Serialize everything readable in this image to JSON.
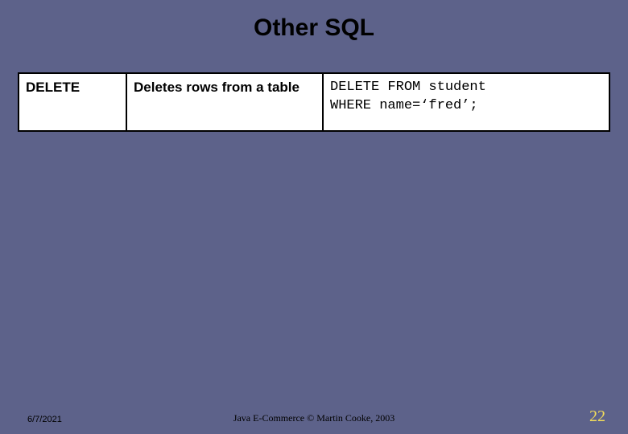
{
  "title": "Other SQL",
  "table": {
    "rows": [
      {
        "keyword": "DELETE",
        "description": "Deletes rows from a table",
        "example_line1": "DELETE FROM student",
        "example_line2": "WHERE name=‘fred’;"
      }
    ]
  },
  "footer": {
    "date": "6/7/2021",
    "copyright": "Java E-Commerce © Martin Cooke, 2003",
    "page": "22"
  }
}
